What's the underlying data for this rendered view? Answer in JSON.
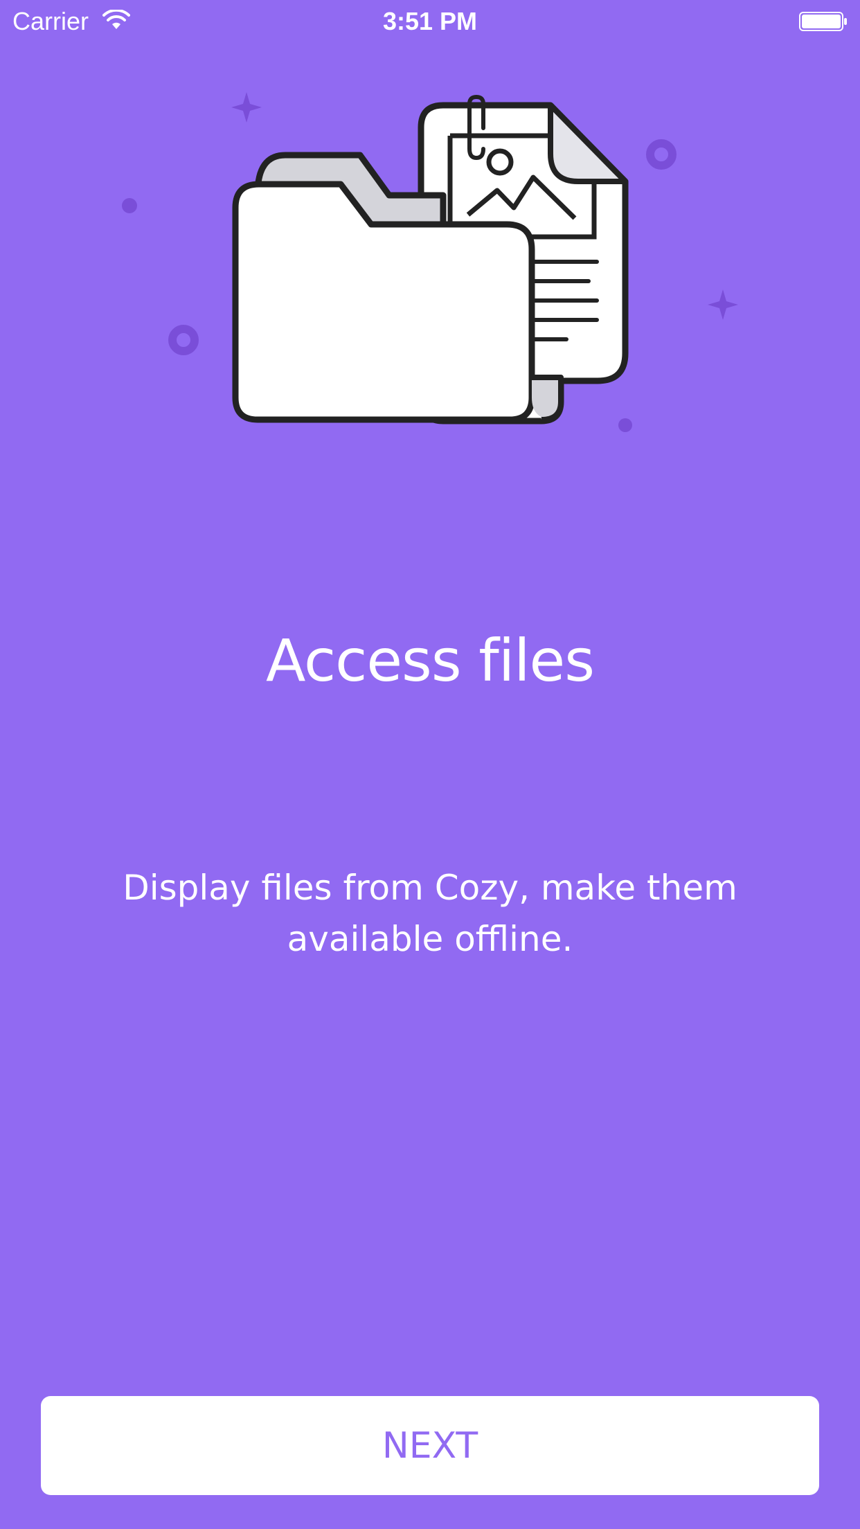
{
  "status_bar": {
    "carrier": "Carrier",
    "time": "3:51 PM",
    "icons": [
      "wifi-icon",
      "battery-icon"
    ]
  },
  "illustration": {
    "icon": "folder-with-files-icon",
    "colors": {
      "sparkle": "#7a4ed8",
      "outline": "#222222",
      "folder_back": "#d4d4da",
      "paper": "#ffffff"
    }
  },
  "onboarding": {
    "title": "Access files",
    "description": "Display files from Cozy, make them available offline."
  },
  "actions": {
    "next_label": "NEXT"
  },
  "colors": {
    "background": "#916af2",
    "button_background": "#ffffff",
    "button_text": "#916af2"
  }
}
